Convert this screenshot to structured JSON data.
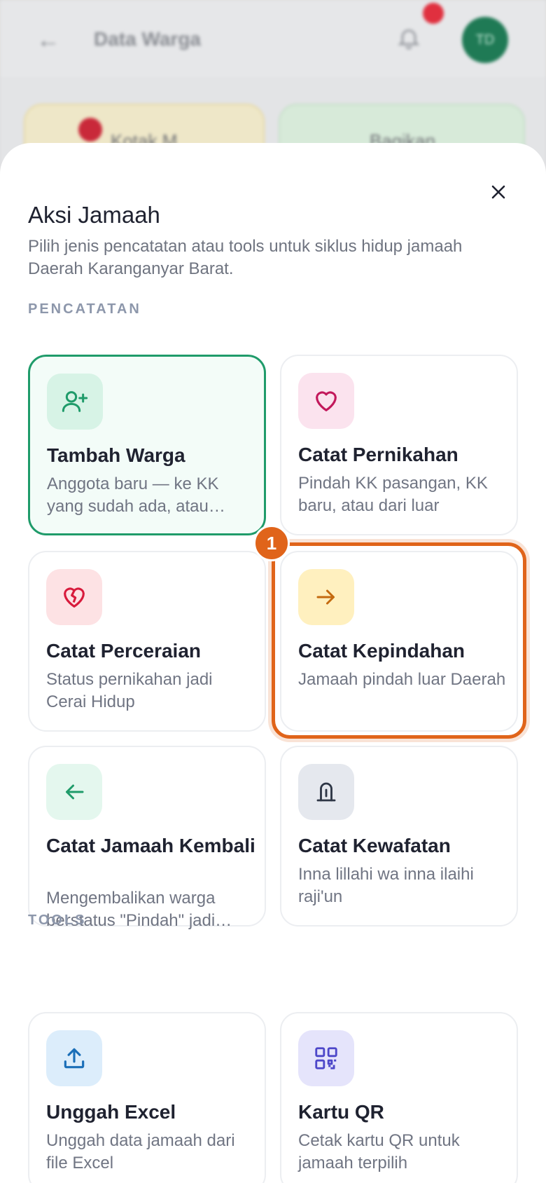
{
  "background": {
    "title": "Data Warga",
    "avatar_initials": "TD",
    "card_a": "Kotak M",
    "card_b": "Bagikan"
  },
  "sheet": {
    "title": "Aksi Jamaah",
    "subtitle": "Pilih jenis pencatatan atau tools untuk siklus hidup jamaah Daerah Karanganyar Barat.",
    "sections": {
      "pencatatan": "PENCATATAN",
      "tools": "TOOLS"
    },
    "cards": {
      "tambah": {
        "title": "Tambah Warga",
        "desc": "Anggota baru — ke KK yang sudah ada, atau…",
        "icon": "user-plus-icon",
        "color": "#1f9b6a"
      },
      "nikah": {
        "title": "Catat Pernikahan",
        "desc": "Pindah KK pasangan, KK baru, atau dari luar",
        "icon": "heart-icon",
        "color": "#c2185b"
      },
      "cerai": {
        "title": "Catat Perceraian",
        "desc": "Status pernikahan jadi Cerai Hidup",
        "icon": "broken-heart-icon",
        "color": "#d81b3c"
      },
      "pindah": {
        "title": "Catat Kepindahan",
        "desc": "Jamaah pindah luar Daerah",
        "icon": "arrow-right-icon",
        "color": "#c46a10"
      },
      "kembali": {
        "title": "Catat Jamaah Kembali",
        "desc": "Mengembalikan warga berstatus \"Pindah\" jadi…",
        "icon": "arrow-left-icon",
        "color": "#1f9b6a"
      },
      "wafat": {
        "title": "Catat Kewafatan",
        "desc": "Inna lillahi wa inna ilaihi raji'un",
        "icon": "tombstone-icon",
        "color": "#2e3646"
      },
      "excel": {
        "title": "Unggah Excel",
        "desc": "Unggah data jamaah dari file Excel",
        "icon": "upload-icon",
        "color": "#1b6fb8"
      },
      "qr": {
        "title": "Kartu QR",
        "desc": "Cetak kartu QR untuk jamaah terpilih",
        "icon": "qr-code-icon",
        "color": "#4d47c9"
      }
    },
    "highlight_badge": "1"
  }
}
